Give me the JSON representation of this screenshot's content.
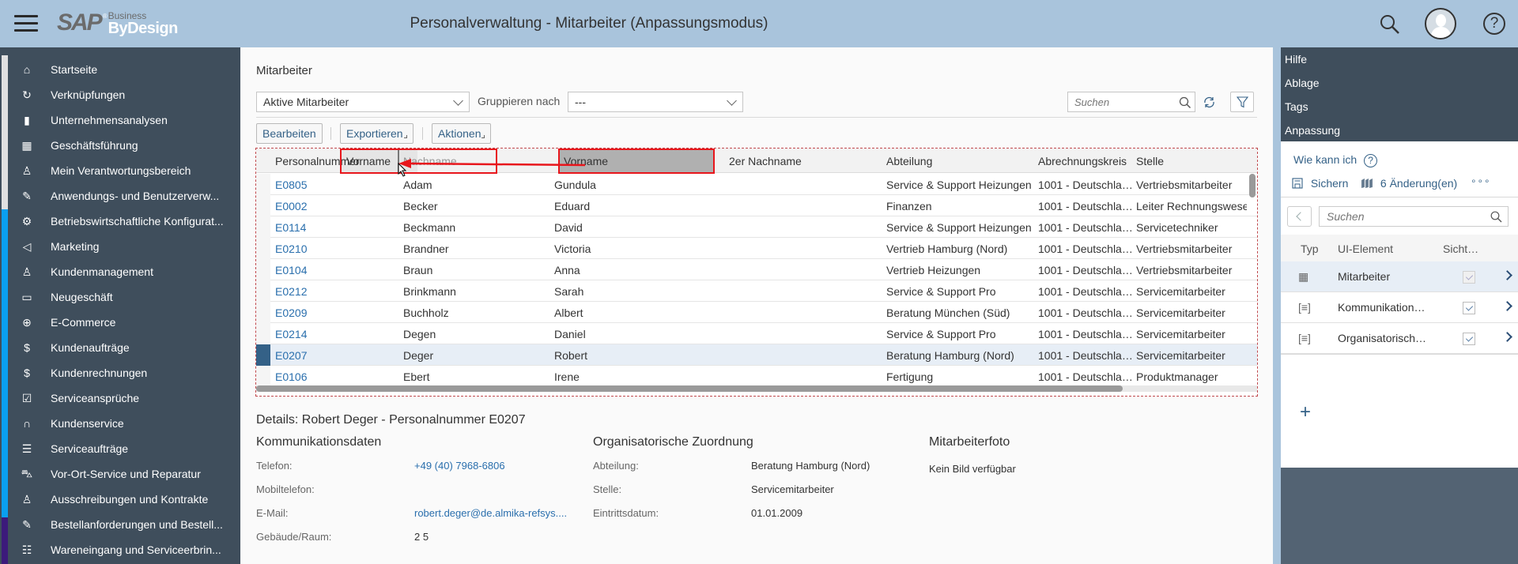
{
  "header": {
    "logo_sap": "SAP",
    "logo_business": "Business",
    "logo_bydesign": "ByDesign",
    "title": "Personalverwaltung - Mitarbeiter (Anpassungsmodus)",
    "icons": [
      "menu-icon",
      "search-icon",
      "user-avatar-icon",
      "help-icon"
    ]
  },
  "sidebar": {
    "items": [
      {
        "label": "Startseite",
        "icon": "home-icon",
        "glyph": "⌂"
      },
      {
        "label": "Verknüpfungen",
        "icon": "shortcut-icon",
        "glyph": "↻"
      },
      {
        "label": "Unternehmensanalysen",
        "icon": "bar-chart-icon",
        "glyph": "▮"
      },
      {
        "label": "Geschäftsführung",
        "icon": "management-icon",
        "glyph": "▦"
      },
      {
        "label": "Mein Verantwortungsbereich",
        "icon": "team-icon",
        "glyph": "♙"
      },
      {
        "label": "Anwendungs- und Benutzerverw...",
        "icon": "user-edit-icon",
        "glyph": "✎"
      },
      {
        "label": "Betriebswirtschaftliche Konfigurat...",
        "icon": "gears-icon",
        "glyph": "⚙"
      },
      {
        "label": "Marketing",
        "icon": "megaphone-icon",
        "glyph": "◁"
      },
      {
        "label": "Kundenmanagement",
        "icon": "customer-icon",
        "glyph": "♙"
      },
      {
        "label": "Neugeschäft",
        "icon": "business-card-icon",
        "glyph": "▭"
      },
      {
        "label": "E-Commerce",
        "icon": "globe-icon",
        "glyph": "⊕"
      },
      {
        "label": "Kundenaufträge",
        "icon": "sales-order-icon",
        "glyph": "$"
      },
      {
        "label": "Kundenrechnungen",
        "icon": "invoice-icon",
        "glyph": "$"
      },
      {
        "label": "Serviceansprüche",
        "icon": "clipboard-check-icon",
        "glyph": "☑"
      },
      {
        "label": "Kundenservice",
        "icon": "headset-icon",
        "glyph": "∩"
      },
      {
        "label": "Serviceaufträge",
        "icon": "clipboard-list-icon",
        "glyph": "☰"
      },
      {
        "label": "Vor-Ort-Service und Reparatur",
        "icon": "car-service-icon",
        "glyph": "⛍"
      },
      {
        "label": "Ausschreibungen und Kontrakte",
        "icon": "bidder-icon",
        "glyph": "♙"
      },
      {
        "label": "Bestellanforderungen und Bestell...",
        "icon": "purchase-edit-icon",
        "glyph": "✎"
      },
      {
        "label": "Wareneingang und Serviceerbrin...",
        "icon": "goods-receipt-icon",
        "glyph": "☷"
      }
    ],
    "strip_colors": [
      "#e0e0e0",
      "#0a9ff0",
      "#3c1a7b"
    ]
  },
  "main": {
    "section_title": "Mitarbeiter",
    "view_dropdown": "Aktive Mitarbeiter",
    "group_label": "Gruppieren nach",
    "group_dropdown": "---",
    "search_placeholder": "Suchen",
    "toolbar": {
      "edit": "Bearbeiten",
      "export": "Exportieren",
      "actions": "Aktionen"
    },
    "columns": [
      "Personalnummer",
      "Nachname",
      "Vorname",
      "2er Nachname",
      "Abteilung",
      "Abrechnungskreis",
      "Stelle"
    ],
    "drag": {
      "ghost_label": "Vorname",
      "placeholder_label": "Nachname",
      "source_label": "Vorname"
    },
    "rows": [
      {
        "id": "E0805",
        "last": "Adam",
        "first": "Gundula",
        "second": "",
        "dept": "Service & Support Heizungen",
        "payroll": "1001 - Deutschla…",
        "position": "Vertriebsmitarbeiter"
      },
      {
        "id": "E0002",
        "last": "Becker",
        "first": "Eduard",
        "second": "",
        "dept": "Finanzen",
        "payroll": "1001 - Deutschla…",
        "position": "Leiter Rechnungswesen"
      },
      {
        "id": "E0114",
        "last": "Beckmann",
        "first": "David",
        "second": "",
        "dept": "Service & Support Heizungen",
        "payroll": "1001 - Deutschla…",
        "position": "Servicetechniker"
      },
      {
        "id": "E0210",
        "last": "Brandner",
        "first": "Victoria",
        "second": "",
        "dept": "Vertrieb Hamburg (Nord)",
        "payroll": "1001 - Deutschla…",
        "position": "Vertriebsmitarbeiter"
      },
      {
        "id": "E0104",
        "last": "Braun",
        "first": "Anna",
        "second": "",
        "dept": "Vertrieb Heizungen",
        "payroll": "1001 - Deutschla…",
        "position": "Vertriebsmitarbeiter"
      },
      {
        "id": "E0212",
        "last": "Brinkmann",
        "first": "Sarah",
        "second": "",
        "dept": "Service & Support Pro",
        "payroll": "1001 - Deutschla…",
        "position": "Servicemitarbeiter"
      },
      {
        "id": "E0209",
        "last": "Buchholz",
        "first": "Albert",
        "second": "",
        "dept": "Beratung München (Süd)",
        "payroll": "1001 - Deutschla…",
        "position": "Servicemitarbeiter"
      },
      {
        "id": "E0214",
        "last": "Degen",
        "first": "Daniel",
        "second": "",
        "dept": "Service & Support Pro",
        "payroll": "1001 - Deutschla…",
        "position": "Servicemitarbeiter"
      },
      {
        "id": "E0207",
        "last": "Deger",
        "first": "Robert",
        "second": "",
        "dept": "Beratung Hamburg (Nord)",
        "payroll": "1001 - Deutschla…",
        "position": "Servicemitarbeiter",
        "selected": true
      },
      {
        "id": "E0106",
        "last": "Ebert",
        "first": "Irene",
        "second": "",
        "dept": "Fertigung",
        "payroll": "1001 - Deutschla…",
        "position": "Produktmanager"
      }
    ],
    "details": {
      "title": "Details: Robert Deger - Personalnummer E0207",
      "comm": {
        "heading": "Kommunikationsdaten",
        "fields": [
          {
            "label": "Telefon:",
            "value": "+49 (40) 7968-6806",
            "link": true
          },
          {
            "label": "Mobiltelefon:",
            "value": ""
          },
          {
            "label": "E-Mail:",
            "value": "robert.deger@de.almika-refsys....",
            "link": true
          },
          {
            "label": "Gebäude/Raum:",
            "value": "2 5"
          }
        ]
      },
      "org": {
        "heading": "Organisatorische Zuordnung",
        "fields": [
          {
            "label": "Abteilung:",
            "value": "Beratung Hamburg (Nord)"
          },
          {
            "label": "Stelle:",
            "value": "Servicemitarbeiter"
          },
          {
            "label": "Eintrittsdatum:",
            "value": "01.01.2009"
          }
        ]
      },
      "photo": {
        "heading": "Mitarbeiterfoto",
        "text": "Kein Bild verfügbar"
      }
    }
  },
  "right_panel": {
    "menu": [
      "Hilfe",
      "Ablage",
      "Tags",
      "Anpassung"
    ],
    "how_to": "Wie kann ich",
    "save": "Sichern",
    "changes": "6 Änderung(en)",
    "more": "...",
    "search_placeholder": "Suchen",
    "columns": [
      "Typ",
      "UI-Element",
      "Sicht…"
    ],
    "rows": [
      {
        "type_icon": "table-icon",
        "glyph": "▦",
        "name": "Mitarbeiter",
        "visible": true,
        "selected": true
      },
      {
        "type_icon": "section-icon",
        "glyph": "[≡]",
        "name": "Kommunikationsdaten",
        "visible": true
      },
      {
        "type_icon": "section-icon",
        "glyph": "[≡]",
        "name": "Organisatorische Zuordnung",
        "visible": true
      }
    ],
    "add": "+"
  }
}
